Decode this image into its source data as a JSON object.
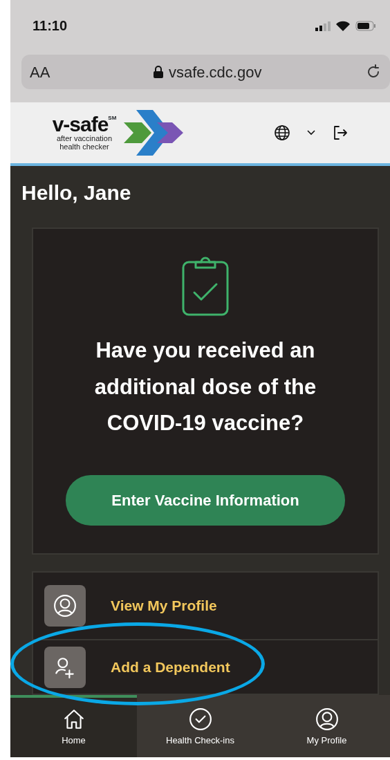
{
  "status_bar": {
    "time": "11:10"
  },
  "browser": {
    "text_size_label": "AA",
    "url": "vsafe.cdc.gov"
  },
  "header": {
    "logo": {
      "name": "v-safe",
      "mark": "SM",
      "tagline": "after vaccination health checker"
    }
  },
  "greeting": "Hello, Jane",
  "prompt_card": {
    "question": "Have you received an additional dose of the COVID-19 vaccine?",
    "button": "Enter Vaccine Information"
  },
  "actions": [
    {
      "kind": "profile",
      "label": "View My Profile",
      "highlighted": false
    },
    {
      "kind": "add-person",
      "label": "Add a Dependent",
      "highlighted": true
    }
  ],
  "bottom_nav": [
    {
      "kind": "home",
      "label": "Home",
      "selected": true
    },
    {
      "kind": "check",
      "label": "Health Check-ins",
      "selected": false
    },
    {
      "kind": "profile",
      "label": "My Profile",
      "selected": false
    }
  ]
}
